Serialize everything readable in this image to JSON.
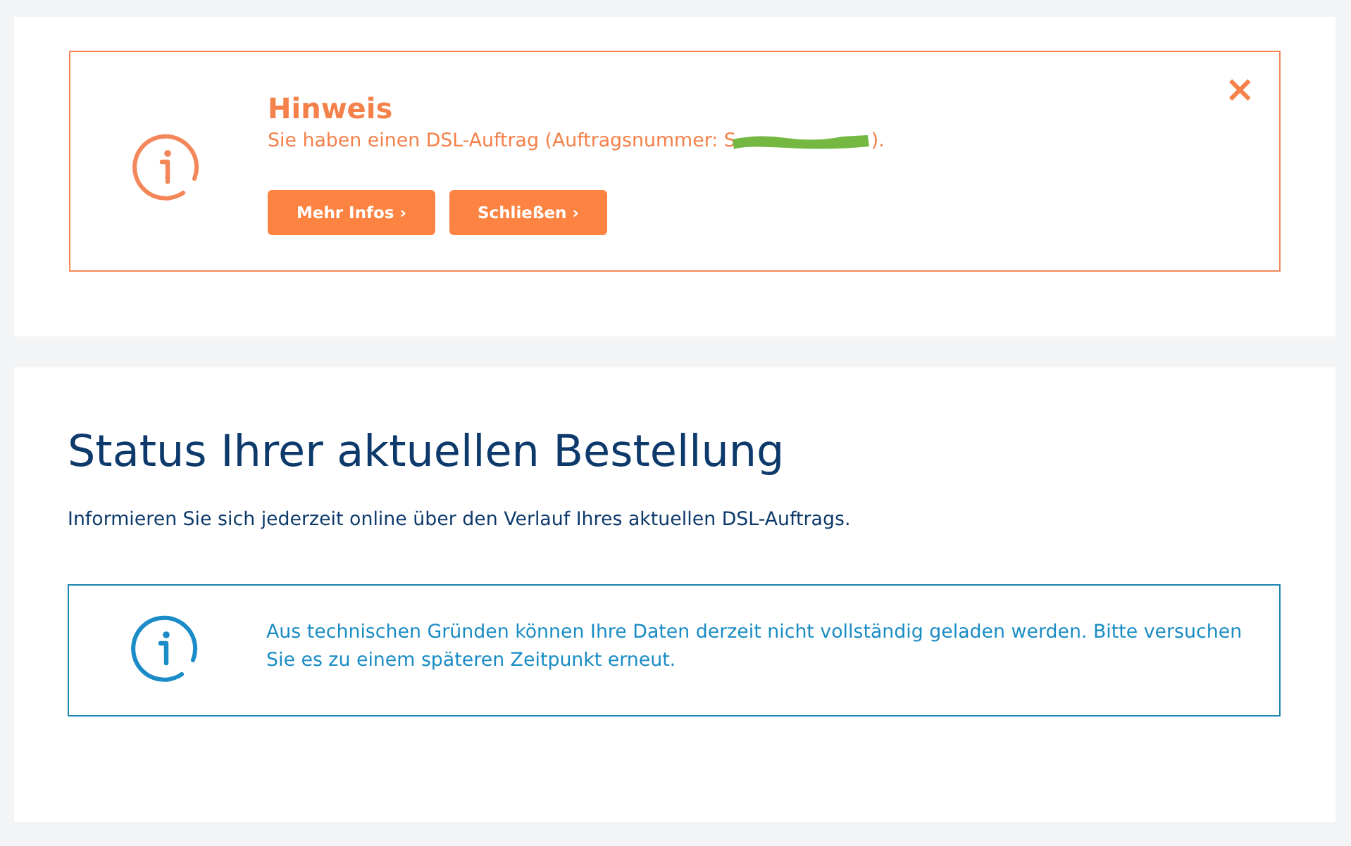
{
  "notice": {
    "title": "Hinweis",
    "message_start": "Sie haben einen DSL-Auftrag (Auftragsnummer: S",
    "message_end": ").",
    "buttons": [
      {
        "label": "Mehr Infos",
        "icon": "›"
      },
      {
        "label": "Schließen",
        "icon": "›"
      }
    ],
    "close": "×"
  },
  "status": {
    "heading": "Status Ihrer aktuellen Bestellung",
    "intro": "Informieren Sie sich jederzeit online über den Verlauf Ihres aktuellen DSL-Auftrags.",
    "info": "Aus technischen Gründen können Ihre Daten derzeit nicht vollständig geladen werden. Bitte versuchen Sie es zu einem späteren Zeitpunkt erneut."
  }
}
